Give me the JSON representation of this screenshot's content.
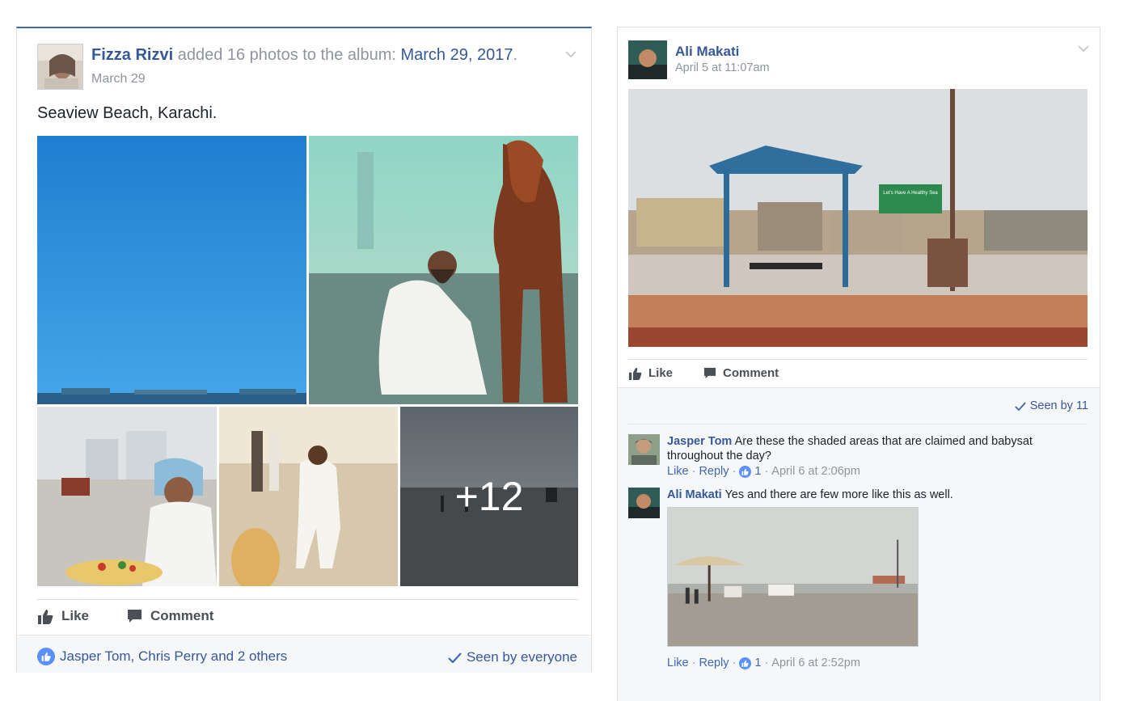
{
  "left_post": {
    "author": "Fizza Rizvi",
    "action_text": "added 16 photos to the album:",
    "album_name": "March 29, 2017",
    "period": ".",
    "date": "March 29",
    "caption": "Seaview Beach, Karachi.",
    "more_photos_count": "+12",
    "like_label": "Like",
    "comment_label": "Comment",
    "reactions_text": "Jasper Tom, Chris Perry and 2 others",
    "seen_text": "Seen by everyone"
  },
  "right_post": {
    "author": "Ali Makati",
    "timestamp": "April 5 at 11:07am",
    "like_label": "Like",
    "comment_label": "Comment",
    "seen_text": "Seen by 11",
    "comments": [
      {
        "author": "Jasper Tom",
        "text": "Are these the shaded areas that are claimed and babysat throughout the day?",
        "like_label": "Like",
        "reply_label": "Reply",
        "likes": "1",
        "time": "April 6 at 2:06pm"
      },
      {
        "author": "Ali Makati",
        "text": "Yes and there are few more like this as well.",
        "like_label": "Like",
        "reply_label": "Reply",
        "likes": "1",
        "time": "April 6 at 2:52pm"
      }
    ],
    "sign_text": "Let's Have A Healthy Sea"
  },
  "colors": {
    "link": "#365899",
    "accent": "#4267b2",
    "meta_gray": "#90949c",
    "like_blue": "#5890ff"
  },
  "icons": [
    "chevron-down-icon",
    "thumbs-up-icon",
    "comment-icon",
    "checkmark-icon",
    "like-reaction-icon"
  ]
}
